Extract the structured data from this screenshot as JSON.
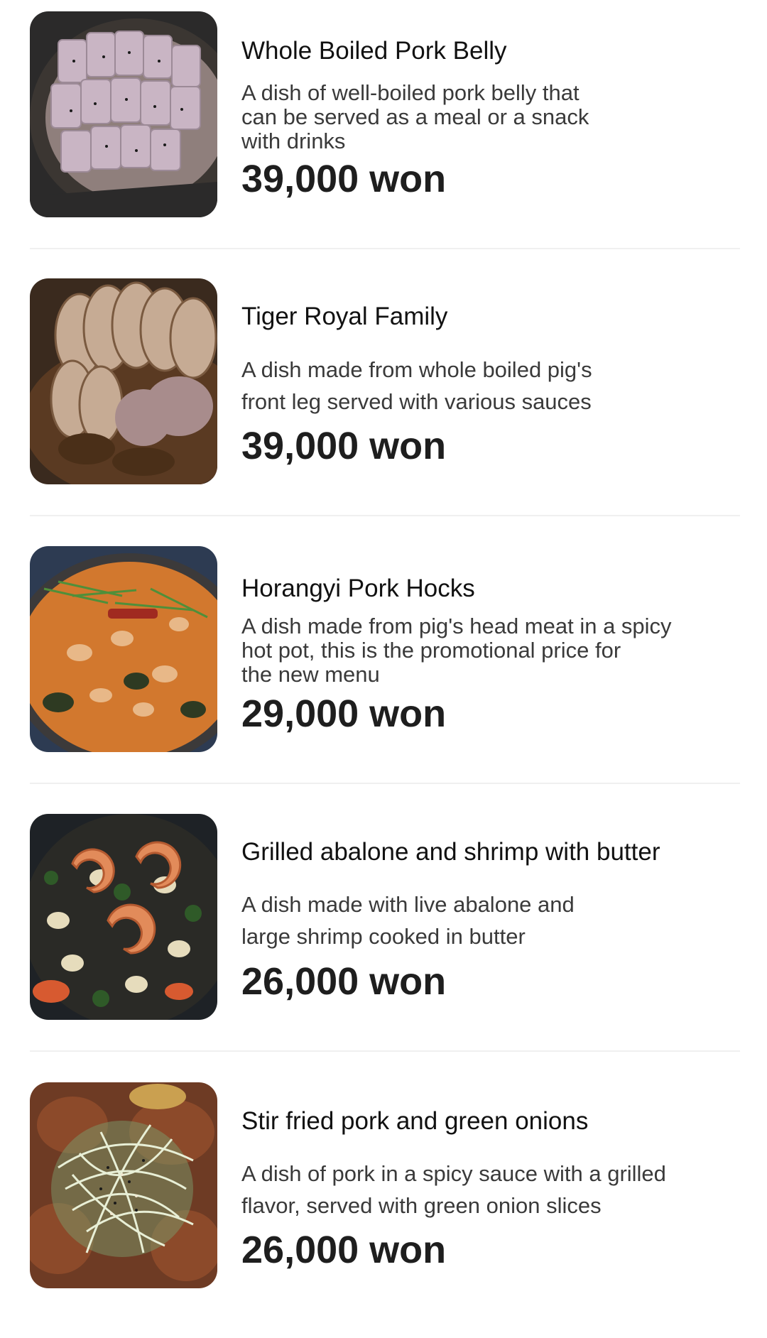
{
  "menu": {
    "items": [
      {
        "name": "Whole Boiled Pork Belly",
        "description": "A dish of well-boiled pork belly that\ncan be served as a meal or a snack\nwith drinks",
        "price": "39,000 won",
        "image_icon": "boiled-pork-belly-photo"
      },
      {
        "name": "Tiger Royal Family",
        "description": "A dish made from whole boiled pig's\nfront leg served with various sauces",
        "price": "39,000 won",
        "image_icon": "boiled-pork-leg-photo"
      },
      {
        "name": "Horangyi Pork Hocks",
        "description": "A dish made from pig's head meat in a spicy\nhot pot, this is the promotional price for\nthe new menu",
        "price": "29,000 won",
        "image_icon": "spicy-hot-pot-photo"
      },
      {
        "name": "Grilled abalone and shrimp with butter",
        "description": "A dish made with live abalone and\nlarge shrimp cooked in butter",
        "price": "26,000 won",
        "image_icon": "abalone-shrimp-photo"
      },
      {
        "name": "Stir fried pork and green onions",
        "description": "A dish of pork in a spicy sauce with a grilled\nflavor, served with green onion slices",
        "price": "26,000 won",
        "image_icon": "stir-fried-pork-photo"
      }
    ]
  }
}
